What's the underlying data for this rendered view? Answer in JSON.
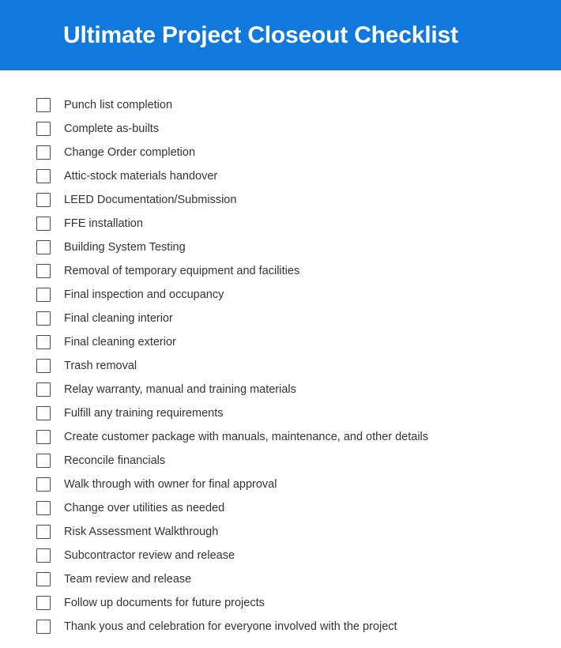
{
  "header": {
    "title": "Ultimate Project Closeout Checklist",
    "background_color": "#1179db",
    "text_color": "#ffffff"
  },
  "checklist": {
    "checkbox_state": "unchecked",
    "text_color": "#333333",
    "items": [
      {
        "label": "Punch list completion"
      },
      {
        "label": "Complete as-builts"
      },
      {
        "label": "Change Order completion"
      },
      {
        "label": "Attic-stock materials handover"
      },
      {
        "label": "LEED Documentation/Submission"
      },
      {
        "label": "FFE installation"
      },
      {
        "label": "Building System Testing"
      },
      {
        "label": "Removal of temporary equipment and facilities"
      },
      {
        "label": "Final inspection and occupancy"
      },
      {
        "label": "Final cleaning interior"
      },
      {
        "label": "Final cleaning exterior"
      },
      {
        "label": "Trash removal"
      },
      {
        "label": "Relay warranty, manual and training materials"
      },
      {
        "label": "Fulfill any training requirements"
      },
      {
        "label": "Create customer package with manuals, maintenance, and other details"
      },
      {
        "label": "Reconcile financials"
      },
      {
        "label": "Walk through with owner for final approval"
      },
      {
        "label": "Change over utilities as needed"
      },
      {
        "label": "Risk Assessment Walkthrough"
      },
      {
        "label": "Subcontractor review and release"
      },
      {
        "label": "Team review and release"
      },
      {
        "label": "Follow up documents for future projects"
      },
      {
        "label": "Thank yous and celebration for everyone involved with the project"
      }
    ]
  }
}
